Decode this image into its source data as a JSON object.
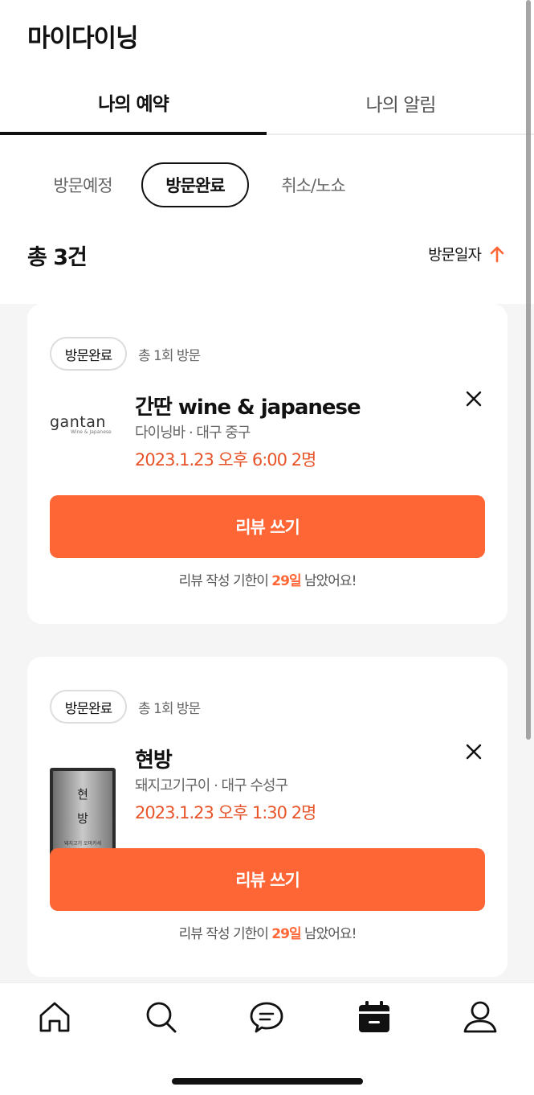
{
  "header": {
    "title": "마이다이닝"
  },
  "tabs": [
    {
      "label": "나의 예약",
      "active": true
    },
    {
      "label": "나의 알림",
      "active": false
    }
  ],
  "filters": [
    {
      "label": "방문예정",
      "selected": false
    },
    {
      "label": "방문완료",
      "selected": true
    },
    {
      "label": "취소/노쇼",
      "selected": false
    }
  ],
  "summary": {
    "total": "총 3건",
    "sort_label": "방문일자",
    "sort_icon": "arrow-up-icon"
  },
  "reservations": [
    {
      "status": "방문완료",
      "visit_count": "총 1회 방문",
      "logo_text": "gantan",
      "logo_sub": "Wine & Japanese",
      "name": "간딴 wine & japanese",
      "meta": "다이닝바 · 대구 중구",
      "when": "2023.1.23 오후 6:00 2명",
      "review_button": "리뷰 쓰기",
      "deadline_prefix": "리뷰 작성 기한이 ",
      "deadline_days": "29일",
      "deadline_suffix": " 남았어요!"
    },
    {
      "status": "방문완료",
      "visit_count": "총 1회 방문",
      "thumb_text_1": "현",
      "thumb_text_2": "방",
      "thumb_caption": "돼지고기 오마카세",
      "name": "현방",
      "meta": "돼지고기구이 · 대구 수성구",
      "when": "2023.1.23 오후 1:30 2명",
      "review_button": "리뷰 쓰기",
      "deadline_prefix": "리뷰 작성 기한이 ",
      "deadline_days": "29일",
      "deadline_suffix": " 남았어요!"
    }
  ],
  "bottom_nav": [
    {
      "icon": "home-icon"
    },
    {
      "icon": "search-icon"
    },
    {
      "icon": "chat-icon"
    },
    {
      "icon": "calendar-icon",
      "active": true
    },
    {
      "icon": "profile-icon"
    }
  ],
  "colors": {
    "accent": "#ff6636",
    "accent_text": "#e8542a"
  }
}
